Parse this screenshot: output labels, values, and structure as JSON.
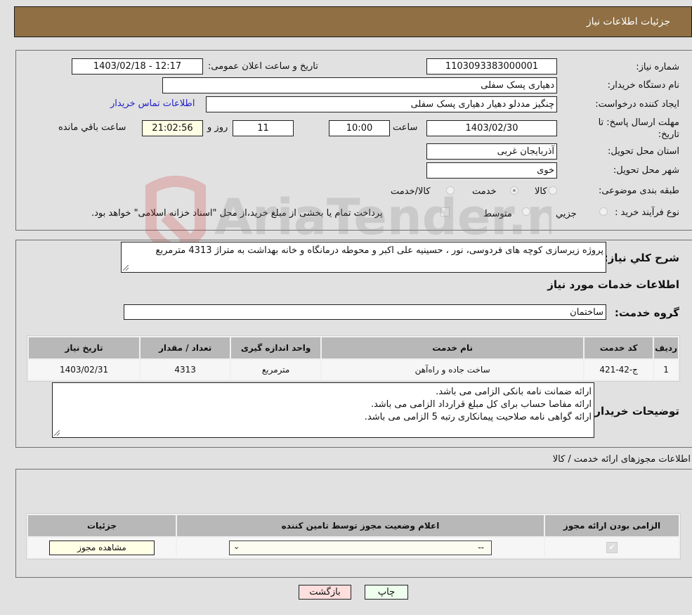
{
  "header": {
    "title": "جزئیات اطلاعات نیاز"
  },
  "form": {
    "need_number_label": "شماره نیاز:",
    "need_number": "1103093383000001",
    "announce_label": "تاریخ و ساعت اعلان عمومی:",
    "announce_value": "1403/02/18 - 12:17",
    "buyer_org_label": "نام دستگاه خریدار:",
    "buyer_org": "دهیاری پسک سفلی",
    "requester_label": "ایجاد کننده درخواست:",
    "requester": "چنگیز مددلو دهیار دهیاری پسک سفلی",
    "buyer_contact_link": "اطلاعات تماس خریدار",
    "deadline_label": "مهلت ارسال پاسخ: تا تاریخ:",
    "deadline_date": "1403/02/30",
    "time_label": "ساعت",
    "deadline_time": "10:00",
    "days_value": "11",
    "days_label": "روز و",
    "remaining_time": "21:02:56",
    "remaining_label": "ساعت باقي مانده",
    "province_label": "استان محل تحویل:",
    "province": "آذربایجان غربی",
    "city_label": "شهر محل تحویل:",
    "city": "خوی",
    "category_label": "طبقه بندی موضوعی:",
    "category_options": [
      {
        "label": "کالا",
        "checked": false
      },
      {
        "label": "خدمت",
        "checked": true
      },
      {
        "label": "کالا/خدمت",
        "checked": false
      }
    ],
    "process_label": "نوع فرآیند خرید :",
    "process_options": [
      {
        "label": "جزيي",
        "checked": false
      },
      {
        "label": "متوسط",
        "checked": false
      }
    ],
    "process_note": "پرداخت تمام یا بخشی از مبلغ خرید،از محل \"اسناد خزانه اسلامی\" خواهد بود."
  },
  "description": {
    "label": "شرح کلي نياز:",
    "text": "پروژه زیرسازی کوچه های فردوسی، نور ، حسینیه علی اکبر و محوطه درمانگاه و خانه بهداشت به متراژ 4313 مترمربع"
  },
  "services": {
    "section_title": "اطلاعات خدمات مورد نیاز",
    "group_label": "گروه خدمت:",
    "group_value": "ساختمان",
    "columns": [
      "ردیف",
      "کد خدمت",
      "نام خدمت",
      "واحد اندازه گیری",
      "تعداد / مقدار",
      "تاریخ نیاز"
    ],
    "rows": [
      [
        "1",
        "ج-42-421",
        "ساخت جاده و راه‌آهن",
        "مترمربع",
        "4313",
        "1403/02/31"
      ]
    ]
  },
  "buyer_notes": {
    "label": "توضیحات خریدار:",
    "lines": [
      "ارائه ضمانت نامه بانکی الزامی می باشد.",
      "ارائه مفاصا حساب برای کل مبلغ قرارداد الزامی می باشد.",
      "ارائه گواهی نامه صلاحیت پیمانکاری رتبه 5 الزامی می باشد."
    ]
  },
  "permits": {
    "section_title": "اطلاعات مجوزهای ارائه خدمت / کالا",
    "columns": [
      "الزامی بودن ارائه مجوز",
      "اعلام وضعیت مجوز توسط تامین کننده",
      "جزئیات"
    ],
    "row": {
      "required_checked": true,
      "status_selected": "--",
      "details_button": "مشاهده مجوز"
    }
  },
  "footer": {
    "print_button": "چاپ",
    "back_button": "بازگشت"
  },
  "colors": {
    "header_bg": "#8f6f43",
    "link": "#2020c8",
    "print_bg": "#eeffee",
    "back_bg": "#ffdede"
  }
}
